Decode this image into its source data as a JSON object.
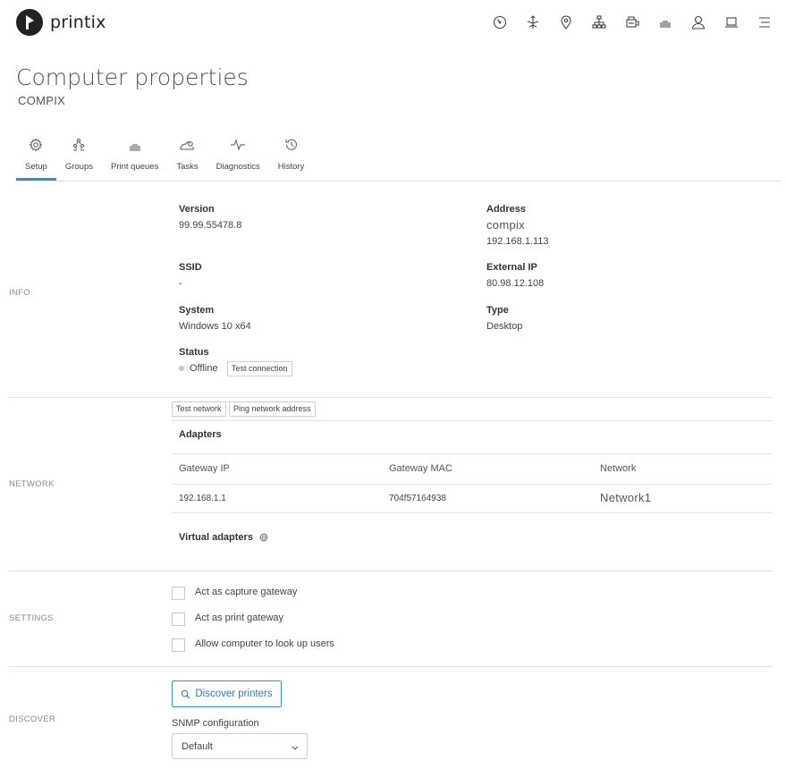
{
  "brand": {
    "name": "printix"
  },
  "nav_icons": [
    "dashboard-icon",
    "network-icon",
    "location-icon",
    "hierarchy-icon",
    "printer-icon",
    "print-queue-icon",
    "user-icon",
    "computer-icon",
    "menu-icon"
  ],
  "page": {
    "title": "Computer properties",
    "subtitle": "COMPIX"
  },
  "tabs": [
    {
      "label": "Setup",
      "icon": "gear-icon",
      "active": true
    },
    {
      "label": "Groups",
      "icon": "groups-icon"
    },
    {
      "label": "Print queues",
      "icon": "print-queue-icon"
    },
    {
      "label": "Tasks",
      "icon": "tasks-icon"
    },
    {
      "label": "Diagnostics",
      "icon": "pulse-icon"
    },
    {
      "label": "History",
      "icon": "history-icon"
    }
  ],
  "info": {
    "section_label": "INFO",
    "version_label": "Version",
    "version_value": "99.99.55478.8",
    "address_label": "Address",
    "address_host": "compix",
    "address_ip": "192.168.1.113",
    "ssid_label": "SSID",
    "ssid_value": "-",
    "external_ip_label": "External IP",
    "external_ip_value": "80.98.12.108",
    "system_label": "System",
    "system_value": "Windows 10 x64",
    "type_label": "Type",
    "type_value": "Desktop",
    "status_label": "Status",
    "status_value": "Offline",
    "test_connection": "Test connection",
    "status_color": "#c8c8c8"
  },
  "network": {
    "section_label": "NETWORK",
    "test_network": "Test network",
    "ping_network": "Ping network address",
    "adapters_label": "Adapters",
    "columns": [
      "Gateway IP",
      "Gateway MAC",
      "Network"
    ],
    "rows": [
      {
        "gateway_ip": "192.168.1.1",
        "gateway_mac": "704f57164938",
        "network": "Network1"
      }
    ],
    "virtual_adapters_label": "Virtual adapters"
  },
  "settings": {
    "section_label": "SETTINGS",
    "options": [
      {
        "label": "Act as capture gateway",
        "checked": false
      },
      {
        "label": "Act as print gateway",
        "checked": false
      },
      {
        "label": "Allow computer to look up users",
        "checked": false
      }
    ]
  },
  "discover": {
    "section_label": "DISCOVER",
    "button_label": "Discover printers",
    "snmp_label": "SNMP configuration",
    "snmp_value": "Default"
  },
  "colors": {
    "accent": "#3a8fc7",
    "divider": "#e2e2e2"
  }
}
